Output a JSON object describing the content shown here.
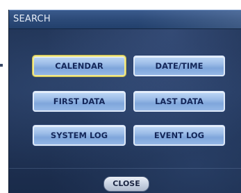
{
  "dialog": {
    "title": "SEARCH"
  },
  "buttons": {
    "calendar": "CALENDAR",
    "date_time": "DATE/TIME",
    "first_data": "FIRST DATA",
    "last_data": "LAST DATA",
    "system_log": "SYSTEM LOG",
    "event_log": "EVENT LOG",
    "close": "CLOSE"
  },
  "state": {
    "selected_button": "CALENDAR"
  },
  "colors": {
    "titlebar": "#2c4a78",
    "panel": "#22365a",
    "button_face": "#9dbde8",
    "button_text": "#14275a",
    "selected_outline": "#f2ea8a"
  }
}
